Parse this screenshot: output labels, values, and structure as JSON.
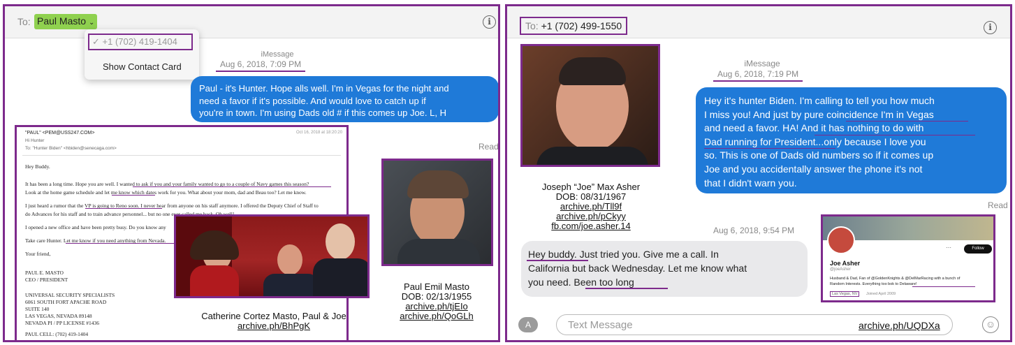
{
  "left": {
    "to_label": "To:",
    "contact_name": "Paul Masto",
    "dropdown": {
      "phone": "✓ +1 (702) 419-1404",
      "show_card": "Show Contact Card"
    },
    "service": "iMessage",
    "timestamp": "Aug 6, 2018, 7:09 PM",
    "message_lines": [
      "Paul - it's Hunter. Hope alls well. I'm in Vegas for the night and",
      "need a favor if it's possible. And would love to catch up if",
      "you're in town.  I'm using Dads old # if this comes up Joe.  L, H"
    ],
    "read_label": "Read",
    "email": {
      "from": "\"PAUL\" <PEM@USS247.COM>",
      "date": "Oct 16, 2018 at 18:20:20",
      "greeting_hdr": "Hi Hunter",
      "to": "To: \"Hunter Biden\" <hbiden@senecaga.com>",
      "lines": [
        "Hey Buddy.",
        "It has been a long time.  Hope you are well.  I wanted to ask if you and your family wanted to go to a couple of  Navy games this season?",
        "Look at the home game schedule and let me know which dates work for you.  What about your mom, dad and Beau too?  Let me know.",
        "I just heard a rumor that the VP is going to Reno soon.  I never hear from anyone on his staff anymore.  I offered the Deputy Chief of Staff to",
        "do Advances for his staff and to train advance personnel... but no one ever called me back.  Oh well!",
        "I opened a new office and have been pretty busy.  Do you know any",
        "Take care Hunter.  Let me know if you need anything from Nevada.",
        "Your friend,",
        "PAUL  E.  MASTO",
        "CEO / PRESIDENT",
        "UNIVERSAL  SECURITY  SPECIALISTS",
        "6061  SOUTH  FORT  APACHE  ROAD",
        "SUITE  140",
        "LAS  VEGAS,  NEVADA  89148",
        "NEVADA  PI / PP  LICENSE  #1436",
        "PAUL  CELL:  (702)  419-1404"
      ]
    },
    "caption_group": {
      "line1": "Catherine Cortez Masto, Paul & Joe",
      "link": "archive.ph/BhPgK"
    },
    "caption_paul": {
      "line1": "Paul Emil Masto",
      "line2": "DOB: 02/13/1955",
      "link1": "archive.ph/tjEIo",
      "link2": "archive.ph/QoGLh"
    }
  },
  "right": {
    "to_label": "To:",
    "phone": "+1 (702) 499-1550",
    "service": "iMessage",
    "timestamp1": "Aug 6, 2018, 7:19 PM",
    "message_lines": [
      "Hey it's hunter Biden. I'm calling to tell you how much",
      "I miss you! And just by pure coincidence I'm in Vegas",
      "and need a favor. HA! And it has nothing to do with",
      "Dad running for President...only because I love you",
      "so. This is one of Dads old numbers so if it comes up",
      "Joe and you accidentally answer the phone it's not",
      "that I didn't warn you."
    ],
    "read_label": "Read",
    "caption_joe": {
      "line1": "Joseph “Joe” Max Asher",
      "line2": "DOB: 08/31/1967",
      "link1": "archive.ph/Tll9f",
      "link2": "archive.ph/pCkyy",
      "link3": "fb.com/joe.asher.14"
    },
    "timestamp2": "Aug 6, 2018, 9:54 PM",
    "reply_lines": [
      "Hey buddy.  Just tried you. Give me a call.  In",
      "California but back Wednesday. Let me know what",
      "you need. Been too long"
    ],
    "profile": {
      "name": "Joe Asher",
      "handle": "@joeAsher",
      "follow": "Follow",
      "bio1": "Husband & Dad, Fan of @GoldenKnights & @DelMarRacing with a bunch of",
      "bio2": "Random Interests. Everything too bok to Delaware!",
      "location": "Las Vegas, NV",
      "joined": "Joined April 2009"
    },
    "input_placeholder": "Text Message",
    "archive_link": "archive.ph/UQDXa"
  },
  "colors": {
    "accent": "#7d2a8c",
    "imessage_blue": "#1f7ad8",
    "highlight_green": "#8fd14f"
  }
}
